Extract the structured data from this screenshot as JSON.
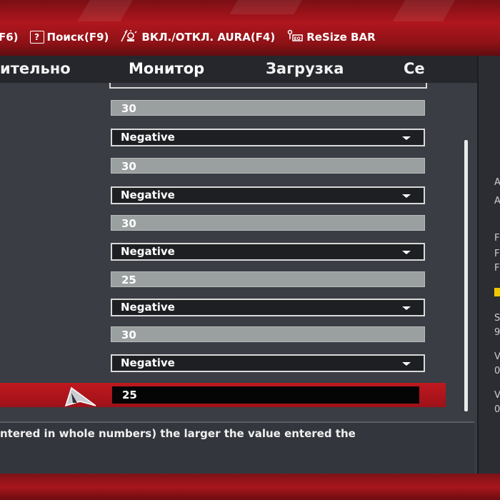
{
  "hotkeys": [
    {
      "label": "F6)",
      "icon": "none"
    },
    {
      "label": "Поиск(F9)",
      "icon": "question-box-icon",
      "box": "?"
    },
    {
      "label": "ВКЛ./ОТКЛ. AURA(F4)",
      "icon": "aura-light-icon"
    },
    {
      "label": "ReSize BAR",
      "icon": "resize-bar-icon"
    }
  ],
  "tabs": [
    {
      "label": "ительно"
    },
    {
      "label": "Монитор"
    },
    {
      "label": "Загрузка"
    },
    {
      "label": "Се"
    }
  ],
  "settings": [
    {
      "type": "number",
      "value": "30"
    },
    {
      "type": "select",
      "value": "Negative"
    },
    {
      "type": "number",
      "value": "30"
    },
    {
      "type": "select",
      "value": "Negative"
    },
    {
      "type": "number",
      "value": "30"
    },
    {
      "type": "select",
      "value": "Negative"
    },
    {
      "type": "number",
      "value": "25"
    },
    {
      "type": "select",
      "value": "Negative"
    },
    {
      "type": "number",
      "value": "30"
    },
    {
      "type": "select",
      "value": "Negative"
    }
  ],
  "active_input": {
    "value": "25"
  },
  "help": {
    "text": "ntered in whole numbers) the larger the value entered the"
  },
  "right_panel": {
    "items": [
      "A",
      "A",
      "F",
      "F",
      "F",
      "S",
      "9",
      "V",
      "0",
      "V",
      "0"
    ]
  },
  "colors": {
    "accent_red": "#b0161d",
    "highlight_yellow": "#f0c800",
    "panel_dark": "#25272c"
  }
}
